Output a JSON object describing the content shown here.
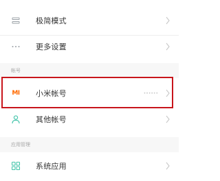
{
  "settings_list": {
    "rows": [
      {
        "label": "极简模式",
        "icon": "simple-mode-icon"
      },
      {
        "label": "更多设置",
        "icon": "more-dots-icon"
      }
    ]
  },
  "accounts_section": {
    "header": "帐号",
    "rows": [
      {
        "label": "小米帐号",
        "icon": "mi-logo-icon",
        "logo_text": "MI",
        "value": "••••••"
      },
      {
        "label": "其他帐号",
        "icon": "person-icon"
      }
    ]
  },
  "apps_section": {
    "header": "应用管理",
    "rows": [
      {
        "label": "系统应用",
        "icon": "apps-grid-icon"
      }
    ]
  },
  "colors": {
    "highlight": "#c8151b",
    "mi_orange": "#ff6a00",
    "teal_icon": "#3ec3a8"
  }
}
